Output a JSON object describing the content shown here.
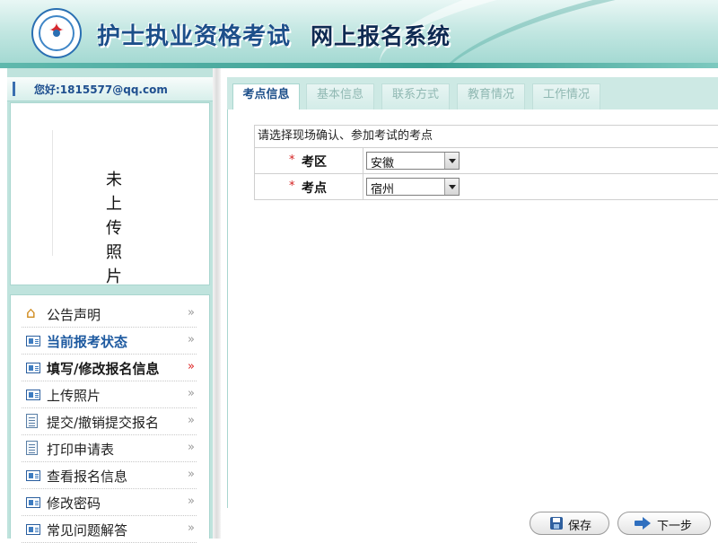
{
  "header": {
    "title_main": "护士执业资格考试",
    "title_sub": "网上报名系统",
    "logo_icon": "nursing-exam-emblem"
  },
  "sidebar": {
    "greeting": "您好:1815577@qq.com",
    "photo_placeholder": "未上传照片",
    "menu": [
      {
        "label": "公告声明",
        "icon": "home-icon",
        "state": "normal"
      },
      {
        "label": "当前报考状态",
        "icon": "card-icon",
        "state": "highlighted"
      },
      {
        "label": "填写/修改报名信息",
        "icon": "card-icon",
        "state": "current"
      },
      {
        "label": "上传照片",
        "icon": "card-icon",
        "state": "normal"
      },
      {
        "label": "提交/撤销提交报名",
        "icon": "document-icon",
        "state": "normal"
      },
      {
        "label": "打印申请表",
        "icon": "document-icon",
        "state": "normal"
      },
      {
        "label": "查看报名信息",
        "icon": "card-icon",
        "state": "normal"
      },
      {
        "label": "修改密码",
        "icon": "card-icon",
        "state": "normal"
      },
      {
        "label": "常见问题解答",
        "icon": "card-icon",
        "state": "normal"
      }
    ]
  },
  "tabs": [
    {
      "label": "考点信息",
      "active": true
    },
    {
      "label": "基本信息",
      "active": false
    },
    {
      "label": "联系方式",
      "active": false
    },
    {
      "label": "教育情况",
      "active": false
    },
    {
      "label": "工作情况",
      "active": false
    }
  ],
  "form": {
    "heading": "请选择现场确认、参加考试的考点",
    "required_mark": "*",
    "fields": [
      {
        "label": "考区",
        "value": "安徽"
      },
      {
        "label": "考点",
        "value": "宿州"
      }
    ]
  },
  "actions": {
    "save_label": "保存",
    "next_label": "下一步"
  },
  "colors": {
    "brand_blue": "#1d4f8a",
    "panel_teal": "#bfe3dd",
    "required_red": "#d42020"
  }
}
